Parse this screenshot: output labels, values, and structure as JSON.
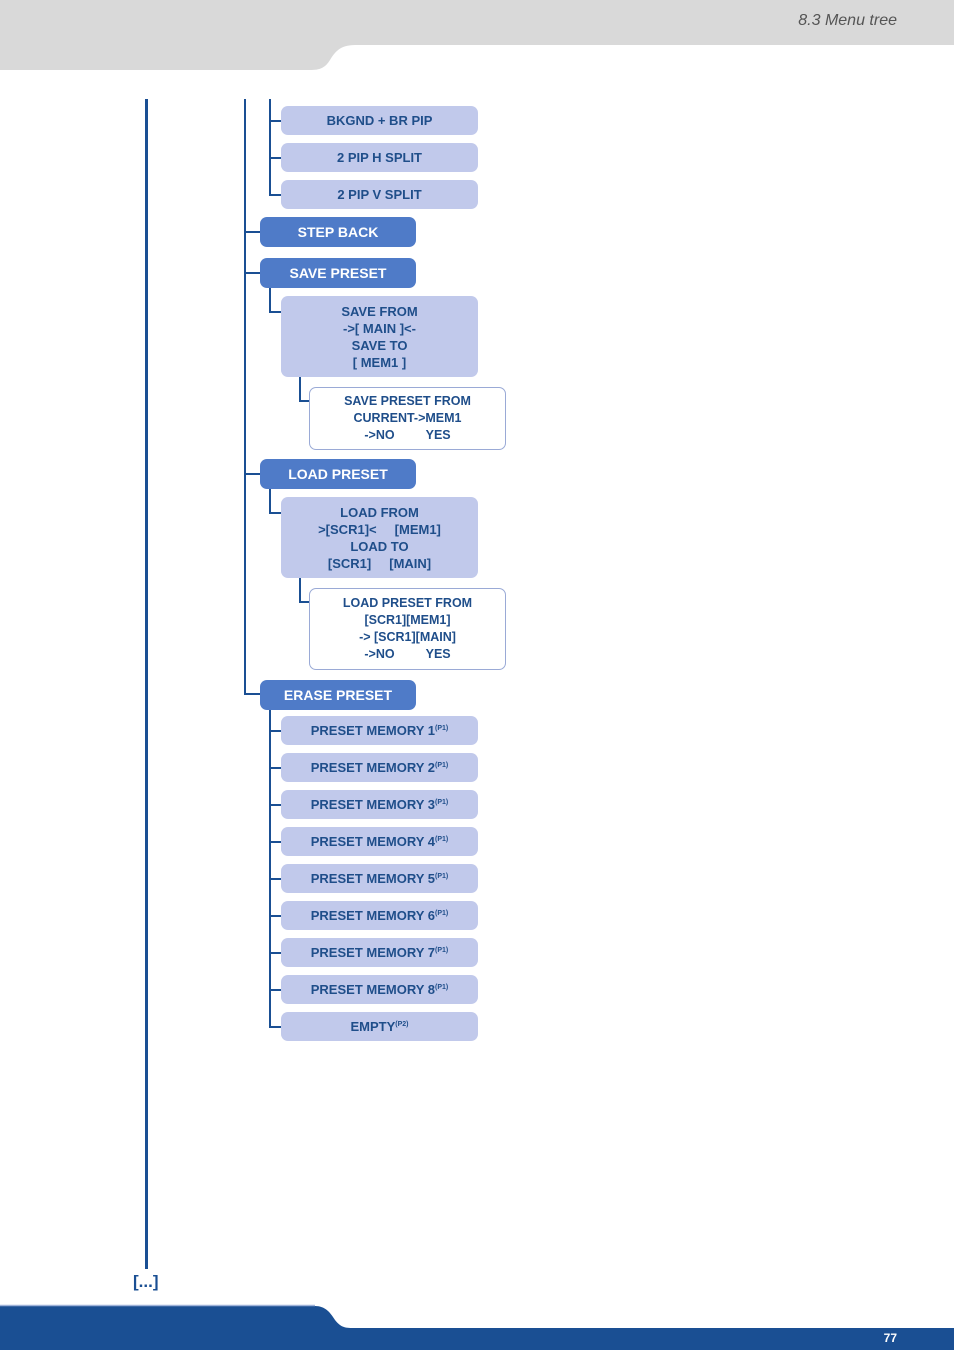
{
  "header": {
    "section_title": "8.3 Menu tree"
  },
  "footer": {
    "page_number": "77",
    "continuation": "[...]"
  },
  "colors": {
    "dark_blue": "#1a4f93",
    "level1": "#4f7bc8",
    "level2": "#c1c9eb",
    "header_gray": "#d9d9d9"
  },
  "tree": {
    "layout_items": [
      "BKGND + BR PIP",
      "2 PIP H SPLIT",
      "2 PIP V SPLIT"
    ],
    "step_back": "STEP BACK",
    "save_preset": {
      "label": "SAVE PRESET",
      "dialog": [
        "SAVE FROM",
        "->[ MAIN ]<-",
        "SAVE TO",
        "[ MEM1 ]"
      ],
      "confirm": [
        "SAVE PRESET FROM",
        "CURRENT->MEM1",
        "->NO         YES"
      ]
    },
    "load_preset": {
      "label": "LOAD PRESET",
      "dialog": [
        "LOAD FROM",
        ">[SCR1]<     [MEM1]",
        "LOAD TO",
        "[SCR1]     [MAIN]"
      ],
      "confirm": [
        "LOAD PRESET FROM",
        "[SCR1][MEM1]",
        "-> [SCR1][MAIN]",
        "->NO         YES"
      ]
    },
    "erase_preset": {
      "label": "ERASE PRESET",
      "items": [
        {
          "label": "PRESET MEMORY 1",
          "note": "(P1)"
        },
        {
          "label": "PRESET MEMORY 2",
          "note": "(P1)"
        },
        {
          "label": "PRESET MEMORY 3",
          "note": "(P1)"
        },
        {
          "label": "PRESET MEMORY 4",
          "note": "(P1)"
        },
        {
          "label": "PRESET MEMORY 5",
          "note": "(P1)"
        },
        {
          "label": "PRESET MEMORY 6",
          "note": "(P1)"
        },
        {
          "label": "PRESET MEMORY 7",
          "note": "(P1)"
        },
        {
          "label": "PRESET MEMORY 8",
          "note": "(P1)"
        },
        {
          "label": "EMPTY",
          "note": "(P2)"
        }
      ]
    }
  }
}
